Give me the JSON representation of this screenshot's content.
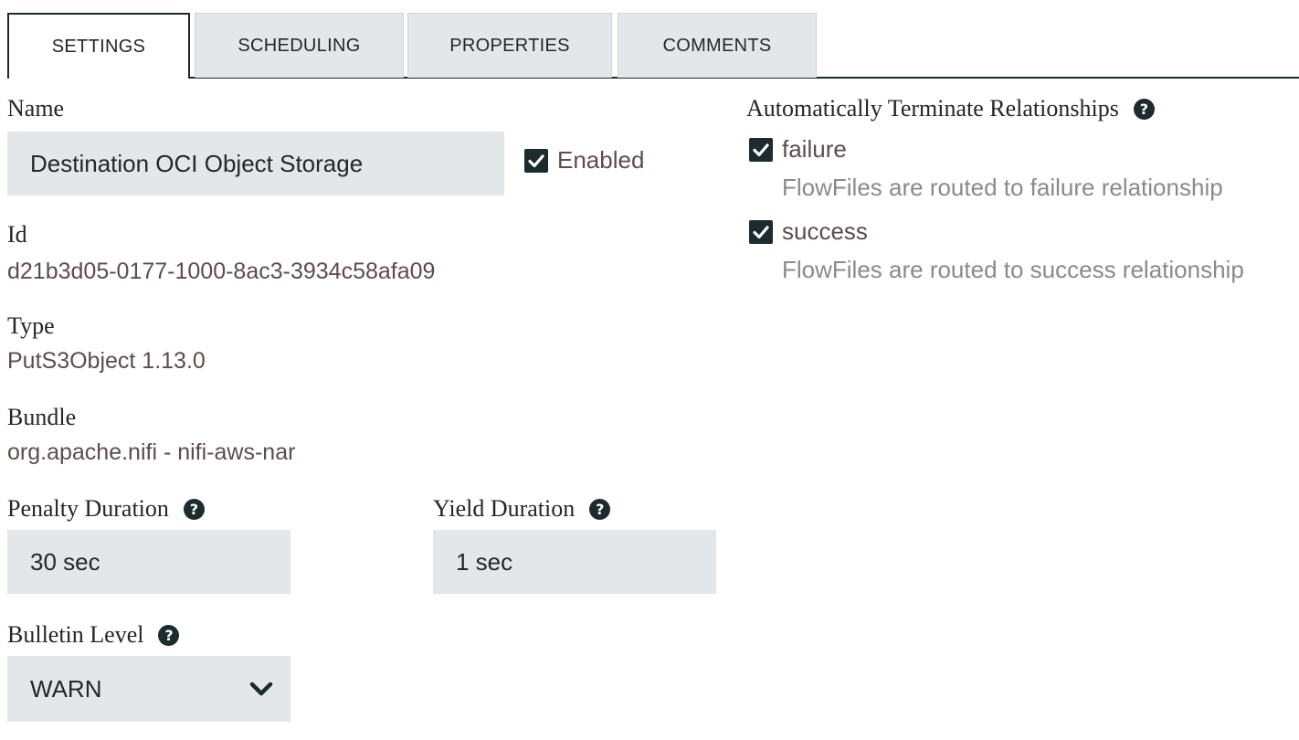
{
  "tabs": [
    {
      "label": "SETTINGS",
      "active": true
    },
    {
      "label": "SCHEDULING",
      "active": false
    },
    {
      "label": "PROPERTIES",
      "active": false
    },
    {
      "label": "COMMENTS",
      "active": false
    }
  ],
  "name": {
    "label": "Name",
    "value": "Destination OCI Object Storage",
    "enabled_label": "Enabled",
    "enabled": true
  },
  "id": {
    "label": "Id",
    "value": "d21b3d05-0177-1000-8ac3-3934c58afa09"
  },
  "type": {
    "label": "Type",
    "value": "PutS3Object 1.13.0"
  },
  "bundle": {
    "label": "Bundle",
    "value": "org.apache.nifi - nifi-aws-nar"
  },
  "penalty": {
    "label": "Penalty Duration",
    "value": "30 sec"
  },
  "yield": {
    "label": "Yield Duration",
    "value": "1 sec"
  },
  "bulletin": {
    "label": "Bulletin Level",
    "value": "WARN"
  },
  "relationships": {
    "title": "Automatically Terminate Relationships",
    "items": [
      {
        "name": "failure",
        "description": "FlowFiles are routed to failure relationship",
        "checked": true
      },
      {
        "name": "success",
        "description": "FlowFiles are routed to success relationship",
        "checked": true
      }
    ]
  },
  "icons": {
    "help": "question-circle-icon",
    "check": "checkmark-icon",
    "dropdown": "chevron-down-icon"
  },
  "colors": {
    "dark": "#1c2b2d",
    "field_bg": "#e4e7ea",
    "value_text": "#5e4c4c",
    "muted_text": "#8a8a8a"
  }
}
